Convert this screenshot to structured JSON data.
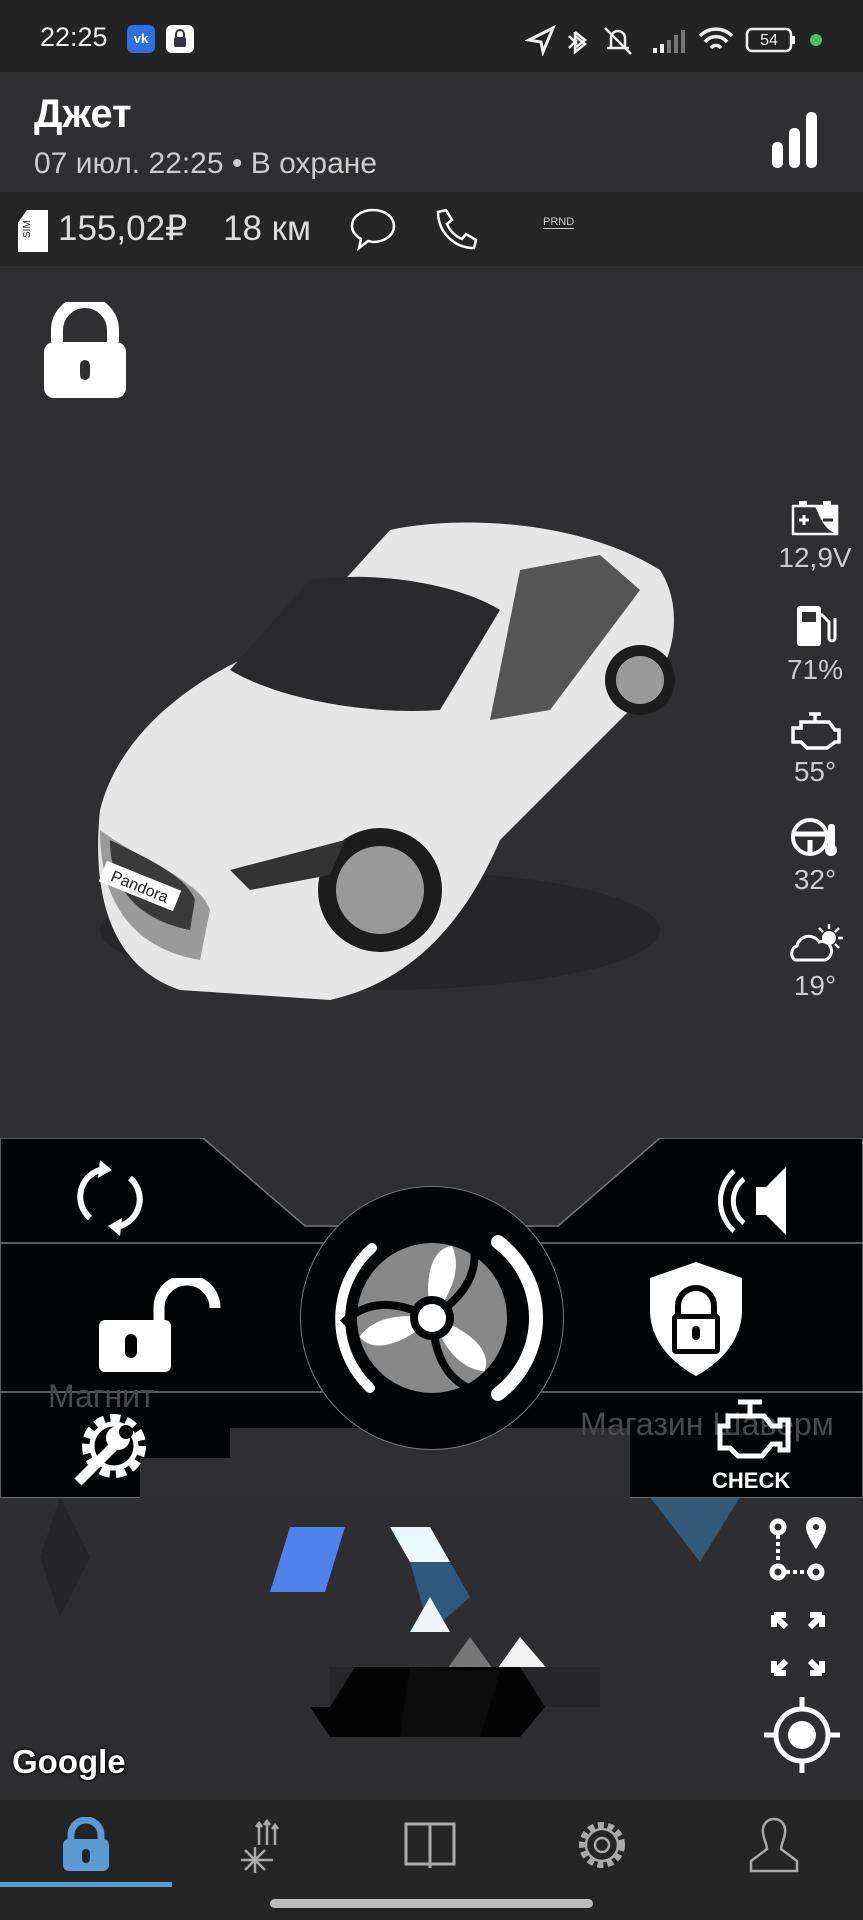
{
  "status_bar": {
    "time": "22:25",
    "battery": "54",
    "app_icons": [
      "vk-icon",
      "lock-app-icon"
    ],
    "system_icons": [
      "location-icon",
      "bluetooth-icon",
      "mute-icon",
      "signal-icon",
      "wifi-icon",
      "battery-icon"
    ]
  },
  "header": {
    "title": "Джет",
    "subtitle": "07 июл. 22:25 • В охране",
    "signal_icon": "signal-bars-icon"
  },
  "info_bar": {
    "balance": "155,02₽",
    "distance": "18 км",
    "sim_label": "SIM",
    "gear_label": "PRND"
  },
  "lock_state_icon": "lock-closed-icon",
  "car_plate": "Pandora",
  "stats": [
    {
      "icon": "battery-icon",
      "value": "12,9V"
    },
    {
      "icon": "fuel-icon",
      "value": "71%"
    },
    {
      "icon": "engine-icon",
      "value": "55°"
    },
    {
      "icon": "steering-temp-icon",
      "value": "32°"
    },
    {
      "icon": "weather-icon",
      "value": "19°"
    }
  ],
  "controls": {
    "check_label": "CHECK",
    "buttons": [
      "refresh",
      "siren",
      "unlock",
      "fan-start",
      "arm",
      "service",
      "check-engine"
    ]
  },
  "map": {
    "attribution": "Google",
    "labels": [
      "Магнит",
      "Магазин Шаверм"
    ]
  },
  "nav": {
    "active_color": "#5b9bd5",
    "tabs": [
      "lock",
      "climate",
      "book",
      "settings",
      "profile"
    ],
    "active": 0
  }
}
